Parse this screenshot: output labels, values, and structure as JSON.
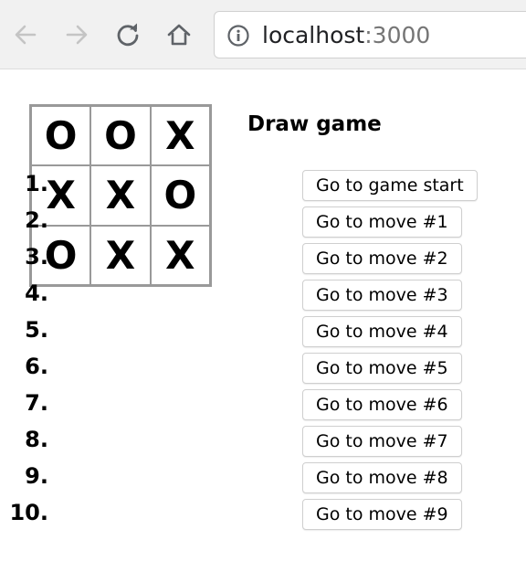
{
  "browser": {
    "address": {
      "host": "localhost",
      "port": ":3000"
    },
    "icons": [
      "back-arrow-icon",
      "forward-arrow-icon",
      "reload-icon",
      "home-icon",
      "info-icon"
    ],
    "colors": {
      "toolbar_bg": "#f1f1f1",
      "icon_active": "#5f6368",
      "icon_disabled": "#c4c4c4",
      "port_text": "#757575"
    }
  },
  "game": {
    "board": {
      "squares": [
        "O",
        "O",
        "X",
        "X",
        "X",
        "O",
        "O",
        "X",
        "X"
      ]
    },
    "status": "Draw game",
    "moves": [
      {
        "num": "1.",
        "label": "Go to game start"
      },
      {
        "num": "2.",
        "label": "Go to move #1"
      },
      {
        "num": "3.",
        "label": "Go to move #2"
      },
      {
        "num": "4.",
        "label": "Go to move #3"
      },
      {
        "num": "5.",
        "label": "Go to move #4"
      },
      {
        "num": "6.",
        "label": "Go to move #5"
      },
      {
        "num": "7.",
        "label": "Go to move #6"
      },
      {
        "num": "8.",
        "label": "Go to move #7"
      },
      {
        "num": "9.",
        "label": "Go to move #8"
      },
      {
        "num": "10.",
        "label": "Go to move #9"
      }
    ]
  }
}
